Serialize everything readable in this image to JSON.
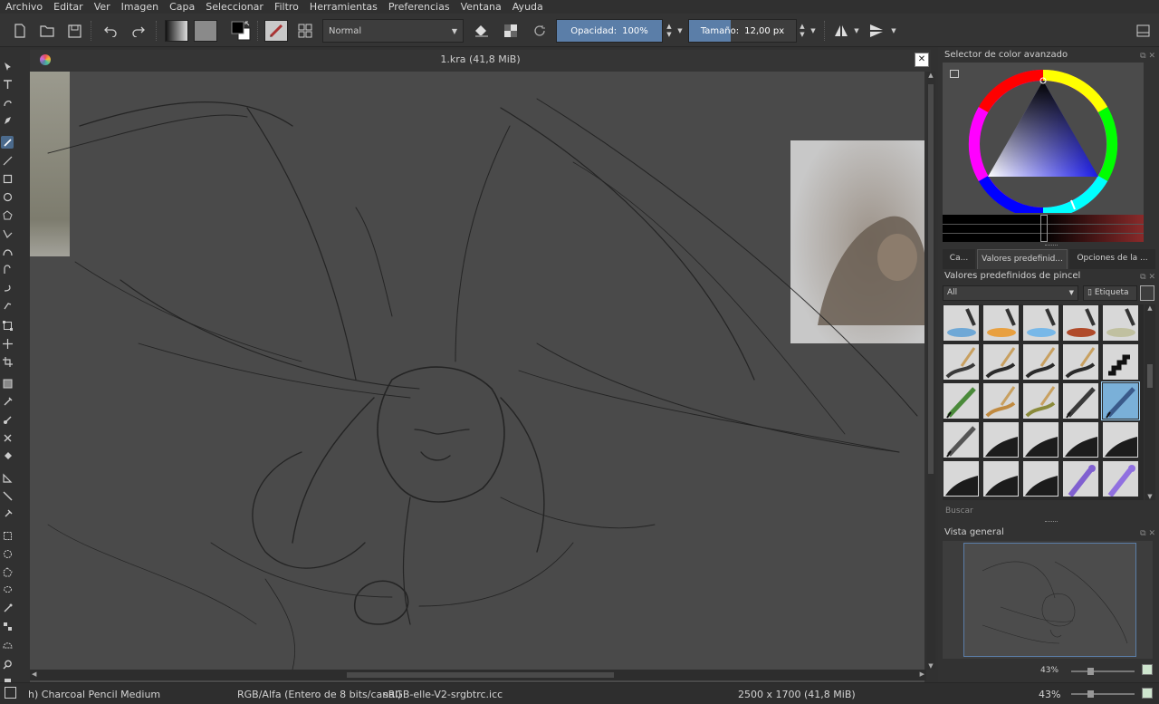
{
  "menu": [
    "Archivo",
    "Editar",
    "Ver",
    "Imagen",
    "Capa",
    "Seleccionar",
    "Filtro",
    "Herramientas",
    "Preferencias",
    "Ventana",
    "Ayuda"
  ],
  "toolbar": {
    "blend_mode": "Normal",
    "opacity_label": "Opacidad:",
    "opacity_value": "100%",
    "size_label": "Tamaño:",
    "size_value": "12,00 px"
  },
  "document": {
    "title": "1.kra (41,8 MiB)"
  },
  "docker": {
    "color_selector_title": "Selector de color avanzado",
    "tabs": [
      "Ca...",
      "Valores predefinid...",
      "Opciones de la ..."
    ],
    "presets_title": "Valores predefinidos de pincel",
    "tag_filter": "All",
    "tag_button": "Etiqueta",
    "search_placeholder": "Buscar",
    "overview_title": "Vista general",
    "zoom_top": "43%",
    "zoom_bottom": "43%"
  },
  "status": {
    "brush": "h) Charcoal Pencil Medium",
    "color_space": "RGB/Alfa (Entero de 8 bits/canal)",
    "profile": "sRGB-elle-V2-srgbtrc.icc",
    "dimensions": "2500 x 1700 (41,8 MiB)",
    "zoom": "43%"
  },
  "colors": {
    "accent": "#5b7ea8",
    "canvas": "#4a4a4a",
    "panel": "#323232"
  }
}
